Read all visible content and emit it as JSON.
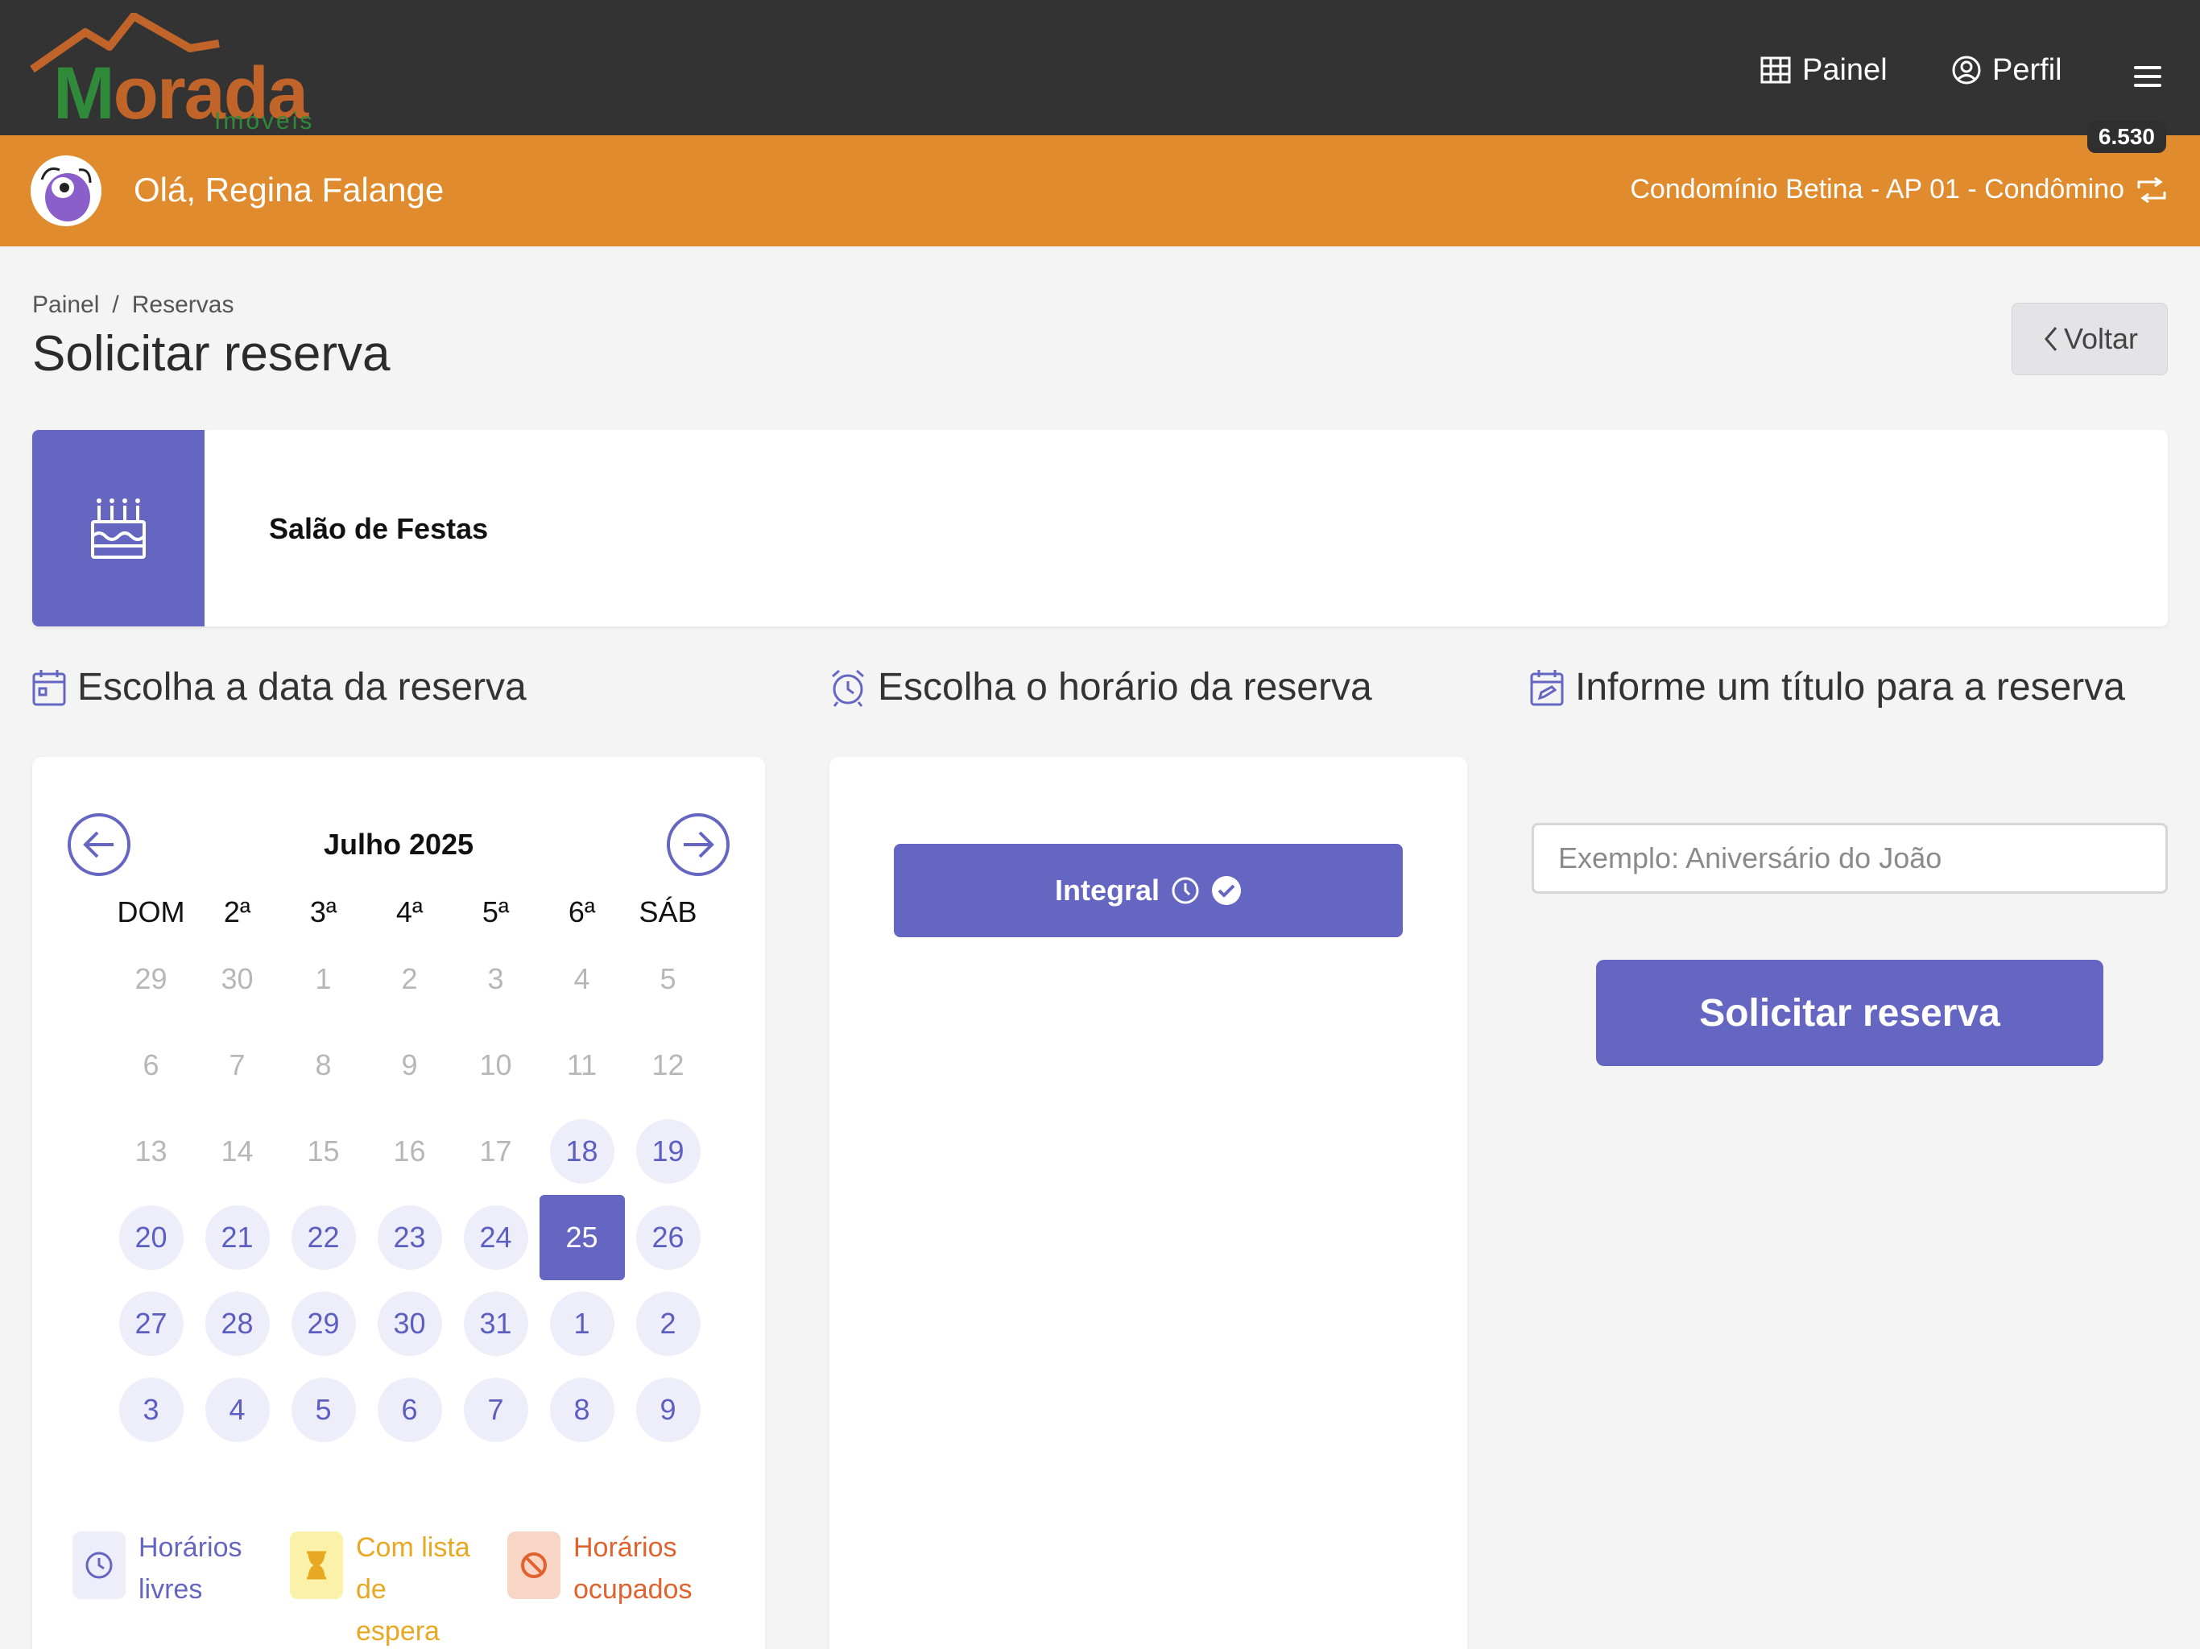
{
  "brand": {
    "logo_text": "Morada",
    "logo_sub": "Imoveis"
  },
  "topnav": {
    "painel_label": "Painel",
    "perfil_label": "Perfil"
  },
  "userbar": {
    "greeting": "Olá, Regina Falange",
    "condo": "Condomínio Betina - AP 01 - Condômino",
    "badge": "6.530"
  },
  "breadcrumb": {
    "items": [
      "Painel",
      "/",
      "Reservas"
    ]
  },
  "page": {
    "title": "Solicitar reserva",
    "back_label": "Voltar"
  },
  "facility": {
    "name": "Salão de Festas",
    "icon": "cake-icon"
  },
  "sections": {
    "date": "Escolha a data da reserva",
    "time": "Escolha o horário da reserva",
    "title": "Informe um título para a reserva"
  },
  "calendar": {
    "month": "Julho 2025",
    "weekdays": [
      "DOM",
      "2ª",
      "3ª",
      "4ª",
      "5ª",
      "6ª",
      "SÁB"
    ],
    "weeks": [
      [
        {
          "d": "29",
          "s": "off"
        },
        {
          "d": "30",
          "s": "off"
        },
        {
          "d": "1",
          "s": "off"
        },
        {
          "d": "2",
          "s": "off"
        },
        {
          "d": "3",
          "s": "off"
        },
        {
          "d": "4",
          "s": "off"
        },
        {
          "d": "5",
          "s": "off"
        }
      ],
      [
        {
          "d": "6",
          "s": "off"
        },
        {
          "d": "7",
          "s": "off"
        },
        {
          "d": "8",
          "s": "off"
        },
        {
          "d": "9",
          "s": "off"
        },
        {
          "d": "10",
          "s": "off"
        },
        {
          "d": "11",
          "s": "off"
        },
        {
          "d": "12",
          "s": "off"
        }
      ],
      [
        {
          "d": "13",
          "s": "off"
        },
        {
          "d": "14",
          "s": "off"
        },
        {
          "d": "15",
          "s": "off"
        },
        {
          "d": "16",
          "s": "off"
        },
        {
          "d": "17",
          "s": "off"
        },
        {
          "d": "18",
          "s": "av"
        },
        {
          "d": "19",
          "s": "av"
        }
      ],
      [
        {
          "d": "20",
          "s": "av"
        },
        {
          "d": "21",
          "s": "av"
        },
        {
          "d": "22",
          "s": "av"
        },
        {
          "d": "23",
          "s": "av"
        },
        {
          "d": "24",
          "s": "av"
        },
        {
          "d": "25",
          "s": "sel"
        },
        {
          "d": "26",
          "s": "av"
        }
      ],
      [
        {
          "d": "27",
          "s": "av"
        },
        {
          "d": "28",
          "s": "av"
        },
        {
          "d": "29",
          "s": "av"
        },
        {
          "d": "30",
          "s": "av"
        },
        {
          "d": "31",
          "s": "av"
        },
        {
          "d": "1",
          "s": "av"
        },
        {
          "d": "2",
          "s": "av"
        }
      ],
      [
        {
          "d": "3",
          "s": "av"
        },
        {
          "d": "4",
          "s": "av"
        },
        {
          "d": "5",
          "s": "av"
        },
        {
          "d": "6",
          "s": "av"
        },
        {
          "d": "7",
          "s": "av"
        },
        {
          "d": "8",
          "s": "av"
        },
        {
          "d": "9",
          "s": "av"
        }
      ]
    ],
    "selected": "25"
  },
  "legend": [
    {
      "label_1": "Horários",
      "label_2": "livres",
      "color": "#6466c2",
      "bg": "#eeeefa",
      "icon": "clock-icon"
    },
    {
      "label_1": "Com lista de",
      "label_2": "espera",
      "color": "#e8a821",
      "bg": "#fbf1a8",
      "icon": "hourglass-icon"
    },
    {
      "label_1": "Horários",
      "label_2": "ocupados",
      "color": "#e0622e",
      "bg": "#f9d5c6",
      "icon": "ban-icon"
    }
  ],
  "timeslot": {
    "label": "Integral"
  },
  "form": {
    "title_placeholder": "Exemplo: Aniversário do João",
    "title_value": "",
    "submit_label": "Solicitar reserva"
  },
  "colors": {
    "primary": "#6466c2",
    "orange": "#e08c2e",
    "dark": "#333333"
  }
}
